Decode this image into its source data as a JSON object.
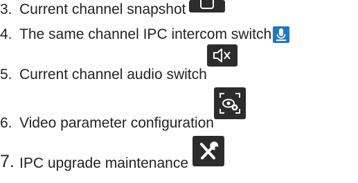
{
  "items": [
    {
      "num": "3.",
      "text": "Current channel snapshot",
      "icon": "camera-icon"
    },
    {
      "num": "4.",
      "text": "The same channel IPC intercom switch",
      "icon": "microphone-icon"
    },
    {
      "num": "5.",
      "text": "Current channel audio switch",
      "icon": "speaker-mute-icon"
    },
    {
      "num": "6.",
      "text": "Video parameter configuration",
      "icon": "camera-settings-icon"
    },
    {
      "num": "7.",
      "text": "IPC upgrade maintenance",
      "icon": "tools-icon"
    }
  ],
  "colors": {
    "text": "#222222",
    "icon_dark": "#2c2c2c",
    "mic_blue": "#1e78c8"
  }
}
